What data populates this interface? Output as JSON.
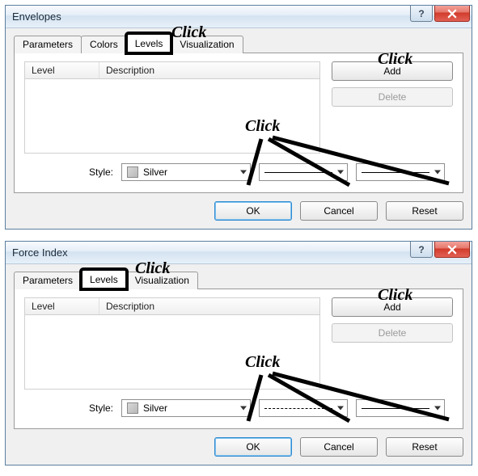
{
  "dialogs": [
    {
      "title": "Envelopes",
      "tabs": [
        "Parameters",
        "Colors",
        "Levels",
        "Visualization"
      ],
      "active_tab": "Levels",
      "highlight_tab": "Levels",
      "columns": {
        "level": "Level",
        "description": "Description"
      },
      "side_buttons": {
        "add": "Add",
        "delete": "Delete"
      },
      "style_label": "Style:",
      "color_name": "Silver",
      "line_style": "solid",
      "buttons": {
        "ok": "OK",
        "cancel": "Cancel",
        "reset": "Reset"
      },
      "annotations": {
        "tab_click": "Click",
        "add_click": "Click",
        "combo_click": "Click"
      }
    },
    {
      "title": "Force Index",
      "tabs": [
        "Parameters",
        "Levels",
        "Visualization"
      ],
      "active_tab": "Levels",
      "highlight_tab": "Levels",
      "columns": {
        "level": "Level",
        "description": "Description"
      },
      "side_buttons": {
        "add": "Add",
        "delete": "Delete"
      },
      "style_label": "Style:",
      "color_name": "Silver",
      "line_style": "dashed",
      "buttons": {
        "ok": "OK",
        "cancel": "Cancel",
        "reset": "Reset"
      },
      "annotations": {
        "tab_click": "Click",
        "add_click": "Click",
        "combo_click": "Click"
      }
    }
  ]
}
